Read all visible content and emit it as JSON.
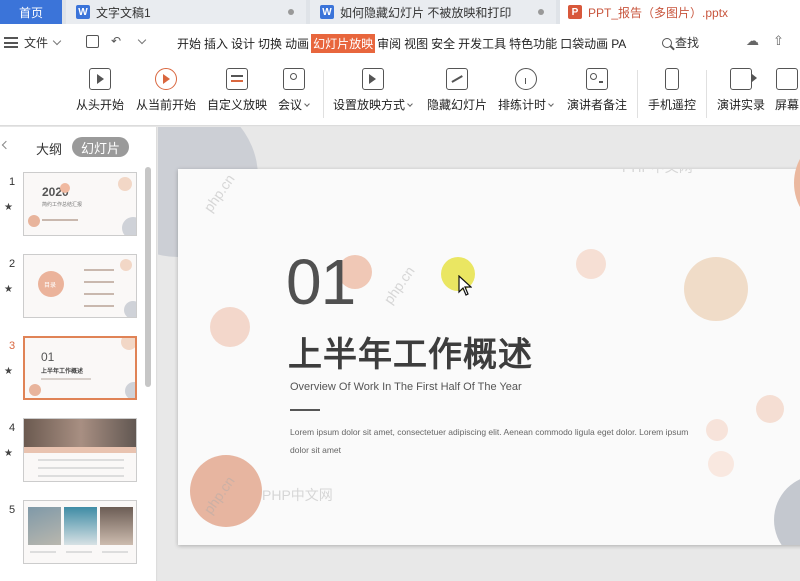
{
  "tabs": {
    "home": "首页",
    "doc1": "文字文稿1",
    "doc2": "如何隐藏幻灯片 不被放映和打印",
    "ppt": "PPT_报告（多图片）.pptx"
  },
  "menu": {
    "file": "文件",
    "tabs": [
      "开始",
      "插入",
      "设计",
      "切换",
      "动画",
      "幻灯片放映",
      "审阅",
      "视图",
      "安全",
      "开发工具",
      "特色功能",
      "口袋动画",
      "PA"
    ],
    "active_tab": "幻灯片放映",
    "search": "查找",
    "accent_color": "#e8663d"
  },
  "ribbon": {
    "from_start": "从头开始",
    "from_current": "从当前开始",
    "custom_show": "自定义放映",
    "meeting": "会议",
    "setup_show": "设置放映方式",
    "hide_slide": "隐藏幻灯片",
    "rehearse": "排练计时",
    "presenter_notes": "演讲者备注",
    "phone_remote": "手机遥控",
    "record": "演讲实录",
    "screen": "屏幕"
  },
  "left_panel": {
    "outline_tab": "大纲",
    "slides_tab": "幻灯片",
    "slide_numbers": [
      "1",
      "2",
      "3",
      "4",
      "5"
    ],
    "star": "★",
    "thumb1_year": "2020",
    "thumb1_caption": "简约工作总结汇报",
    "thumb2_label": "目录",
    "thumb3_num": "01",
    "thumb3_title": "上半年工作概述"
  },
  "slide": {
    "number": "01",
    "title": "上半年工作概述",
    "subtitle": "Overview Of Work In The First Half Of The Year",
    "body": "Lorem ipsum dolor sit amet, consectetuer adipiscing elit. Aenean commodo ligula eget dolor. Lorem ipsum dolor sit amet"
  },
  "watermarks": {
    "site": "PHP中文网",
    "domain": "php.cn"
  }
}
